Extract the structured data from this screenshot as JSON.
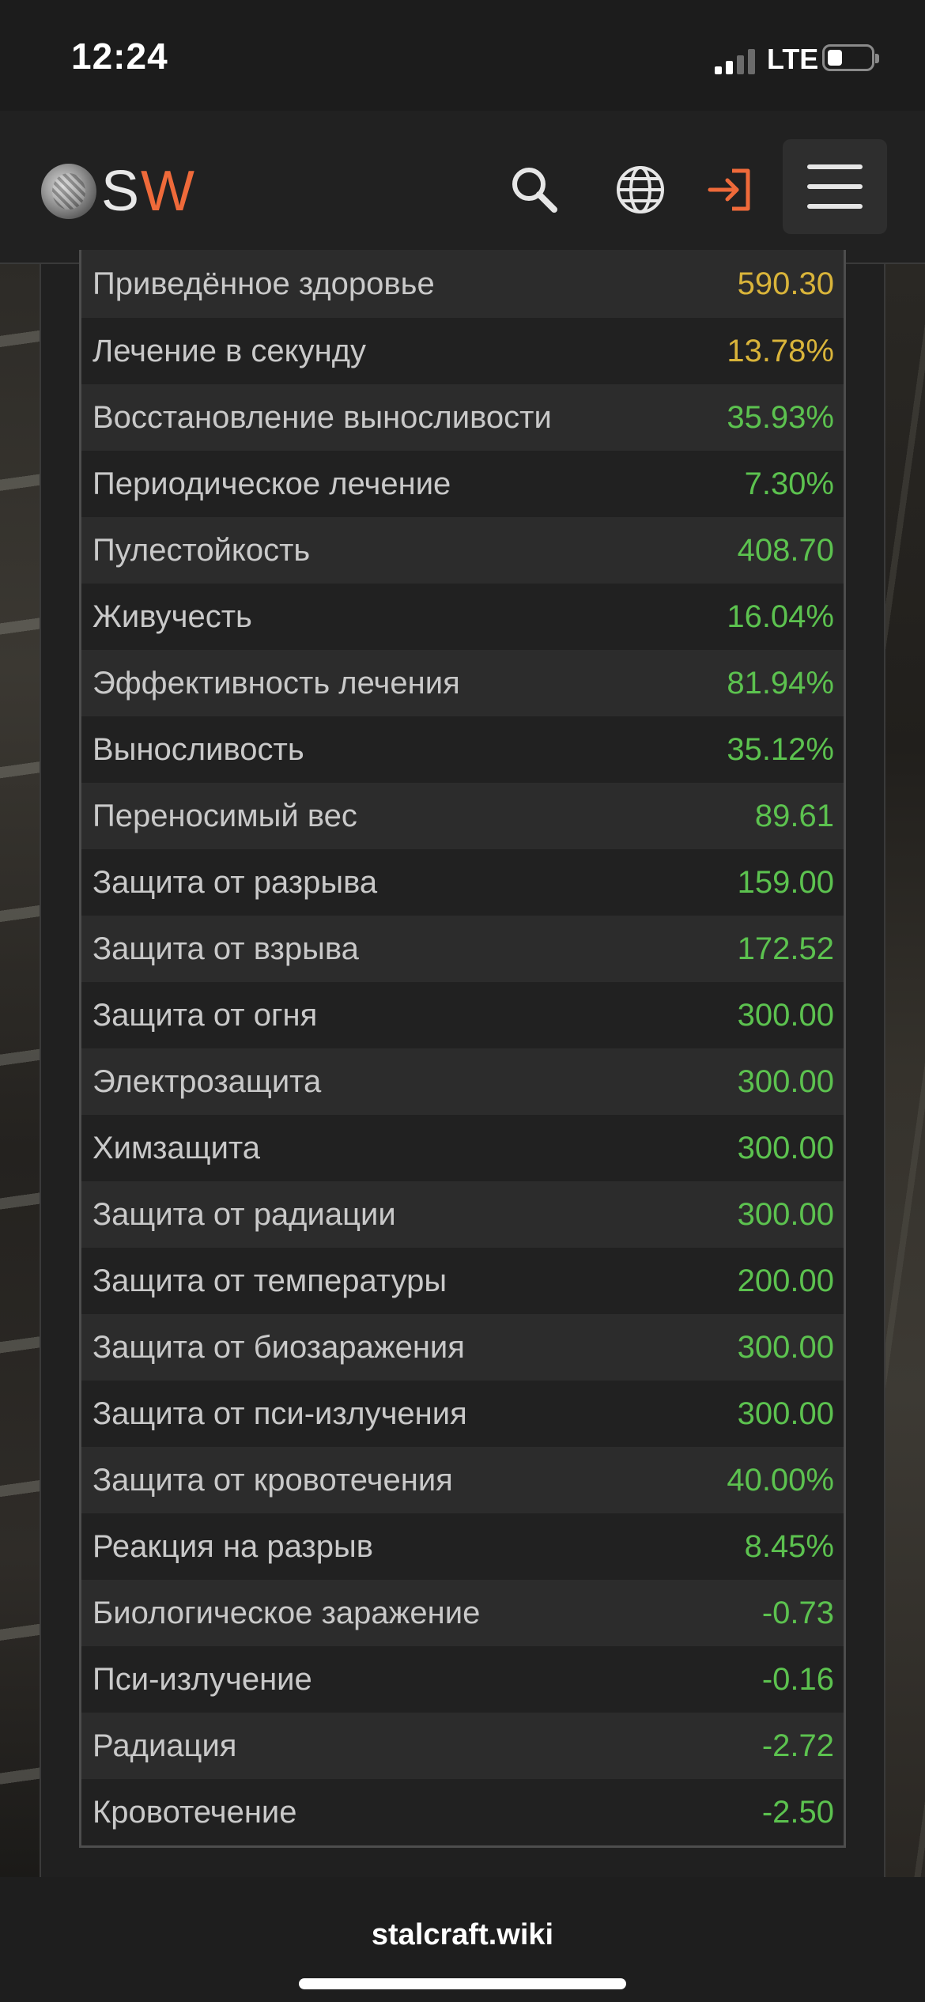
{
  "status_bar": {
    "time": "12:24",
    "network": "LTE"
  },
  "header": {
    "logo_text_s": "S",
    "logo_text_w": "W",
    "icons": [
      "search-icon",
      "globe-icon",
      "login-icon",
      "menu-icon"
    ],
    "login_icon_color": "#ef6a3a"
  },
  "colors": {
    "value_yellow": "#d9b43a",
    "value_green": "#5cc24f",
    "label": "#c9c9c9",
    "brand_orange": "#ef6a3a"
  },
  "stats": [
    {
      "label": "Приведённое здоровье",
      "value": "590.30",
      "tone": "yellow"
    },
    {
      "label": "Лечение в секунду",
      "value": "13.78%",
      "tone": "yellow"
    },
    {
      "label": "Восстановление выносливости",
      "value": "35.93%",
      "tone": "green"
    },
    {
      "label": "Периодическое лечение",
      "value": "7.30%",
      "tone": "green"
    },
    {
      "label": "Пулестойкость",
      "value": "408.70",
      "tone": "green"
    },
    {
      "label": "Живучесть",
      "value": "16.04%",
      "tone": "green"
    },
    {
      "label": "Эффективность лечения",
      "value": "81.94%",
      "tone": "green"
    },
    {
      "label": "Выносливость",
      "value": "35.12%",
      "tone": "green"
    },
    {
      "label": "Переносимый вес",
      "value": "89.61",
      "tone": "green"
    },
    {
      "label": "Защита от разрыва",
      "value": "159.00",
      "tone": "green"
    },
    {
      "label": "Защита от взрыва",
      "value": "172.52",
      "tone": "green"
    },
    {
      "label": "Защита от огня",
      "value": "300.00",
      "tone": "green"
    },
    {
      "label": "Электрозащита",
      "value": "300.00",
      "tone": "green"
    },
    {
      "label": "Химзащита",
      "value": "300.00",
      "tone": "green"
    },
    {
      "label": "Защита от радиации",
      "value": "300.00",
      "tone": "green"
    },
    {
      "label": "Защита от температуры",
      "value": "200.00",
      "tone": "green"
    },
    {
      "label": "Защита от биозаражения",
      "value": "300.00",
      "tone": "green"
    },
    {
      "label": "Защита от пси-излучения",
      "value": "300.00",
      "tone": "green"
    },
    {
      "label": "Защита от кровотечения",
      "value": "40.00%",
      "tone": "green"
    },
    {
      "label": "Реакция на разрыв",
      "value": "8.45%",
      "tone": "green"
    },
    {
      "label": "Биологическое заражение",
      "value": "-0.73",
      "tone": "green"
    },
    {
      "label": "Пси-излучение",
      "value": "-0.16",
      "tone": "green"
    },
    {
      "label": "Радиация",
      "value": "-2.72",
      "tone": "green"
    },
    {
      "label": "Кровотечение",
      "value": "-2.50",
      "tone": "green"
    }
  ],
  "footer": {
    "domain": "stalcraft.wiki"
  }
}
